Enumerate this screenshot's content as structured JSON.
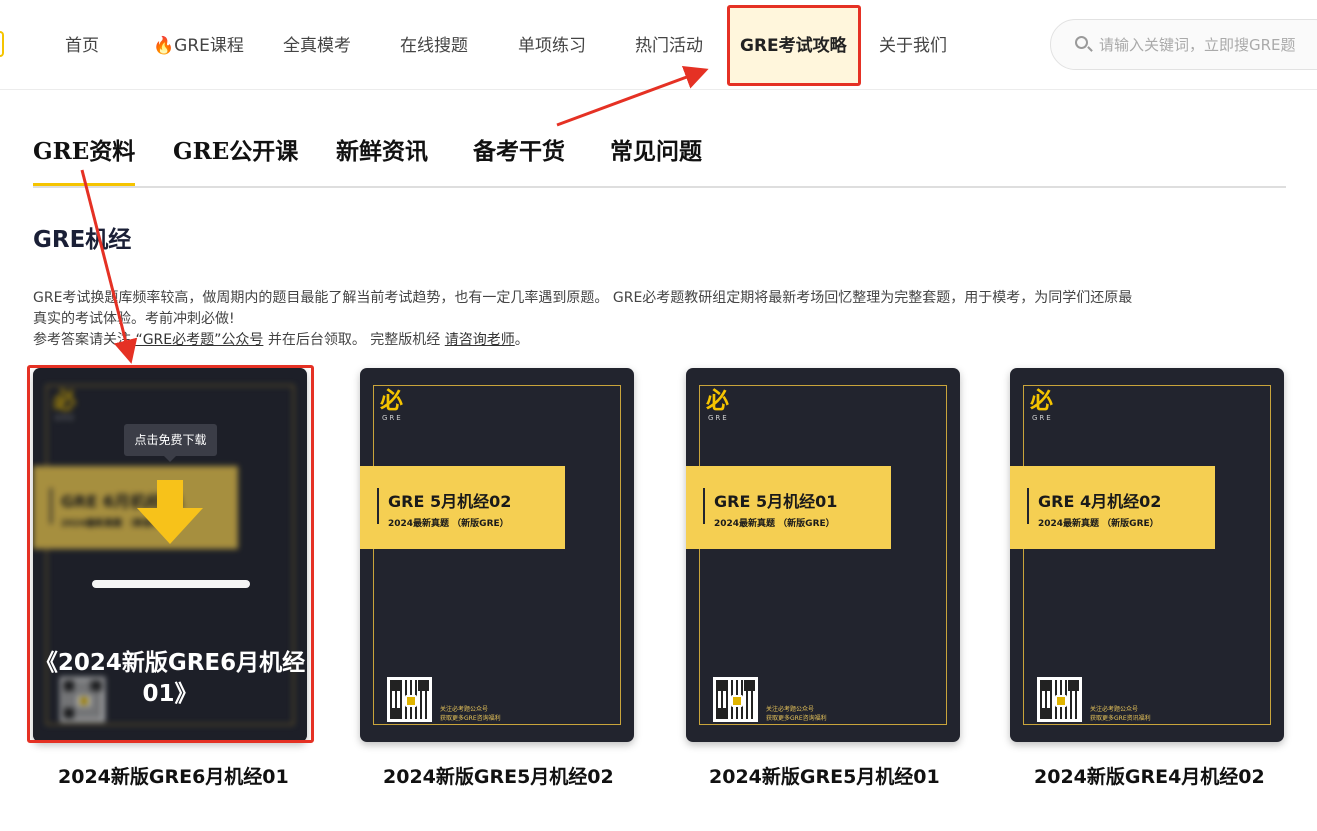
{
  "nav": {
    "items": [
      {
        "label": "首页"
      },
      {
        "icon": "fire-icon",
        "label": "GRE课程"
      },
      {
        "label": "全真模考"
      },
      {
        "label": "在线搜题"
      },
      {
        "label": "单项练习"
      },
      {
        "label": "热门活动"
      },
      {
        "label": "GRE考试攻略",
        "active": true
      },
      {
        "label": "关于我们"
      }
    ],
    "search_placeholder": "请输入关键词，立即搜GRE题"
  },
  "tabs": [
    {
      "label": "GRE资料",
      "active": true
    },
    {
      "label": "GRE公开课"
    },
    {
      "label": "新鲜资讯"
    },
    {
      "label": "备考干货"
    },
    {
      "label": "常见问题"
    }
  ],
  "section": {
    "title": "GRE机经",
    "desc_line1": "GRE考试换题库频率较高，做周期内的题目最能了解当前考试趋势，也有一定几率遇到原题。 GRE必考题教研组定期将最新考场回忆整理为完整套题，用于模考，为同学们还原最",
    "desc_line2": "真实的考试体验。考前冲刺必做!",
    "desc_line3_a": "参考答案请关注",
    "desc_line3_link": "“GRE必考题”公众号",
    "desc_line3_b": "并在后台领取。 完整版机经",
    "desc_line3_link2": "请咨询老师",
    "desc_line3_end": "。"
  },
  "cover": {
    "logo_char": "必",
    "logo_sub": "GRE",
    "band_sub": "2024最新真题 （新版GRE）",
    "follow_l1": "关注必考题公众号",
    "follow_l2": "获取更多GRE咨询福利",
    "follow_l2_alt": "获取更多GRE资讯福利"
  },
  "cards": [
    {
      "band_title": "GRE 6月机经01",
      "title": "2024新版GRE6月机经01",
      "hover": true,
      "tooltip": "点击免费下载",
      "hover_title": "《2024新版GRE6月机经01》"
    },
    {
      "band_title": "GRE 5月机经02",
      "title": "2024新版GRE5月机经02"
    },
    {
      "band_title": "GRE 5月机经01",
      "title": "2024新版GRE5月机经01"
    },
    {
      "band_title": "GRE 4月机经02",
      "title": "2024新版GRE4月机经02"
    }
  ],
  "colors": {
    "accent": "#f5c400",
    "annotation": "#e53124",
    "cover_bg": "#22242e",
    "band": "#f5cf52"
  }
}
